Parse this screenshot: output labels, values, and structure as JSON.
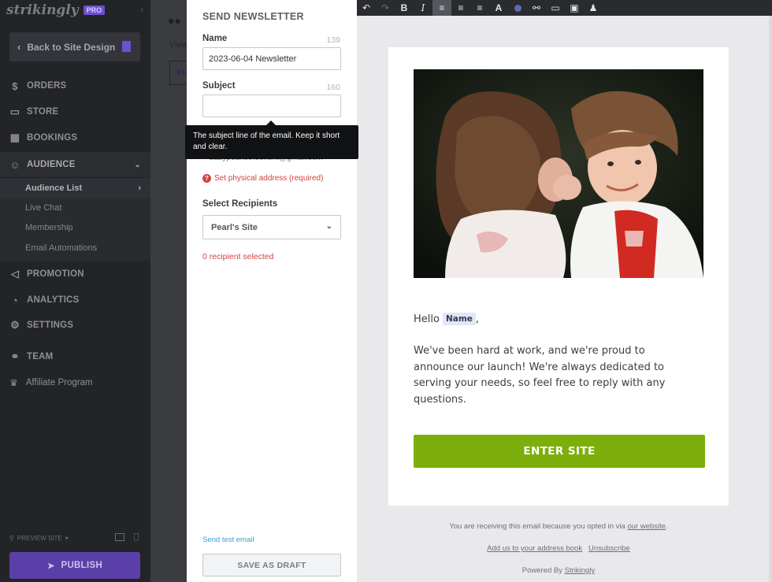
{
  "sidebar": {
    "brand": "strikingly",
    "plan_badge": "PRO",
    "back_label": "Back to Site Design",
    "nav": {
      "orders": "ORDERS",
      "store": "STORE",
      "bookings": "BOOKINGS",
      "audience": "AUDIENCE",
      "promotion": "PROMOTION",
      "analytics": "ANALYTICS",
      "settings": "SETTINGS",
      "team": "TEAM"
    },
    "audience_sub": {
      "list": "Audience List",
      "chat": "Live Chat",
      "membership": "Membership",
      "automations": "Email Automations"
    },
    "affiliate": "Affiliate Program",
    "preview_site": "PREVIEW SITE",
    "publish": "PUBLISH"
  },
  "background": {
    "view_label": "View",
    "box_label": "FU"
  },
  "form": {
    "title": "SEND NEWSLETTER",
    "name_label": "Name",
    "name_count": "139",
    "name_value": "2023-06-04 Newsletter",
    "subject_label": "Subject",
    "subject_count": "160",
    "subject_value": "",
    "tooltip": "The subject line of the email. Keep it short and clear.",
    "from_text": "< babypearlotheorient@gmail.com >",
    "address_warning": "Set physical address (required)",
    "recipients_label": "Select Recipients",
    "recipients_value": "Pearl's Site",
    "recipients_count": "0 recipient selected",
    "test_link": "Send test email",
    "draft_button": "SAVE AS DRAFT"
  },
  "email": {
    "greeting": "Hello",
    "name_tag": "Name",
    "greeting_comma": ",",
    "body": "We've been hard at work, and we're proud to announce our launch! We're always dedicated to serving your needs, so feel free to reply with any questions.",
    "cta": "ENTER SITE",
    "footer_prefix": "You are receiving this email because you opted in via",
    "footer_link": "our website",
    "footer_suffix": ".",
    "add_address_book": "Add us to your address book",
    "unsubscribe": "Unsubscribe",
    "powered_prefix": "Powered By",
    "powered_link": "Strikingly"
  },
  "colors": {
    "accent_purple": "#6e4fd1",
    "cta_green": "#7daf0c",
    "error_red": "#d0453f",
    "link_blue": "#3a9ed6"
  }
}
